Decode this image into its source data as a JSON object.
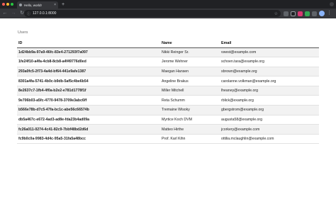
{
  "browser": {
    "tab_title": "Hello, world!",
    "tab_close": "×",
    "new_tab": "+",
    "url": "127.0.0.1:8000",
    "back": "←",
    "forward": "→",
    "reload": "↻",
    "star": "☆",
    "info": "ⓘ",
    "menu": "⋮",
    "icons": [
      "chevron-left-icon",
      "chevron-right-icon",
      "reload-icon",
      "info-icon",
      "star-icon"
    ]
  },
  "table": {
    "title": "Users",
    "columns": [
      "ID",
      "Name",
      "Email"
    ],
    "rows": [
      {
        "id": "1d24bb9a-97a9-46fc-83e4-271293f7a097",
        "name": "Nikki Reinger Sr.",
        "email": "vwest@example.com"
      },
      {
        "id": "1fe24f10-a4fa-4cb8-8cb8-a4f49776d0ed",
        "name": "Jerome Wehner",
        "email": "schoen.tara@example.org"
      },
      {
        "id": "293a0fc5-2f73-4a4d-bf64-441e9afe1387",
        "name": "Maegan Hansen",
        "email": "sbrown@example.org"
      },
      {
        "id": "8301a4fa-5741-4b0c-b9db-5af5c4be6b54",
        "name": "Angeline Brakus",
        "email": "carolanne.volkman@example.org"
      },
      {
        "id": "8e2637c7-1fb4-4f0a-b2e2-e781d1778f1f",
        "name": "Miller Mitchell",
        "email": "lheaney@example.org"
      },
      {
        "id": "9e706b03-a5fc-4770-9478-3709e3abc6ff",
        "name": "Reta Schumm",
        "email": "rblick@example.org"
      },
      {
        "id": "b566e78b-d7c5-47fa-bc1c-abe56c66574b",
        "name": "Tremaine Wisoky",
        "email": "gbergstrom@example.org"
      },
      {
        "id": "db5a467c-e672-4ad3-ad8e-fda23b4ad09a",
        "name": "Myrtice Koch DVM",
        "email": "augusta58@example.org"
      },
      {
        "id": "fc26a011-0274-4c41-82c9-7bbf48bd2d6d",
        "name": "Matteo Hirthe",
        "email": "jcorkery@example.com"
      },
      {
        "id": "fc9b0c0a-9983-4d4c-95a5-31fa5a48bcc",
        "name": "Prof. Karl Kihn",
        "email": "ottilia.mclaughlin@example.com"
      }
    ]
  }
}
